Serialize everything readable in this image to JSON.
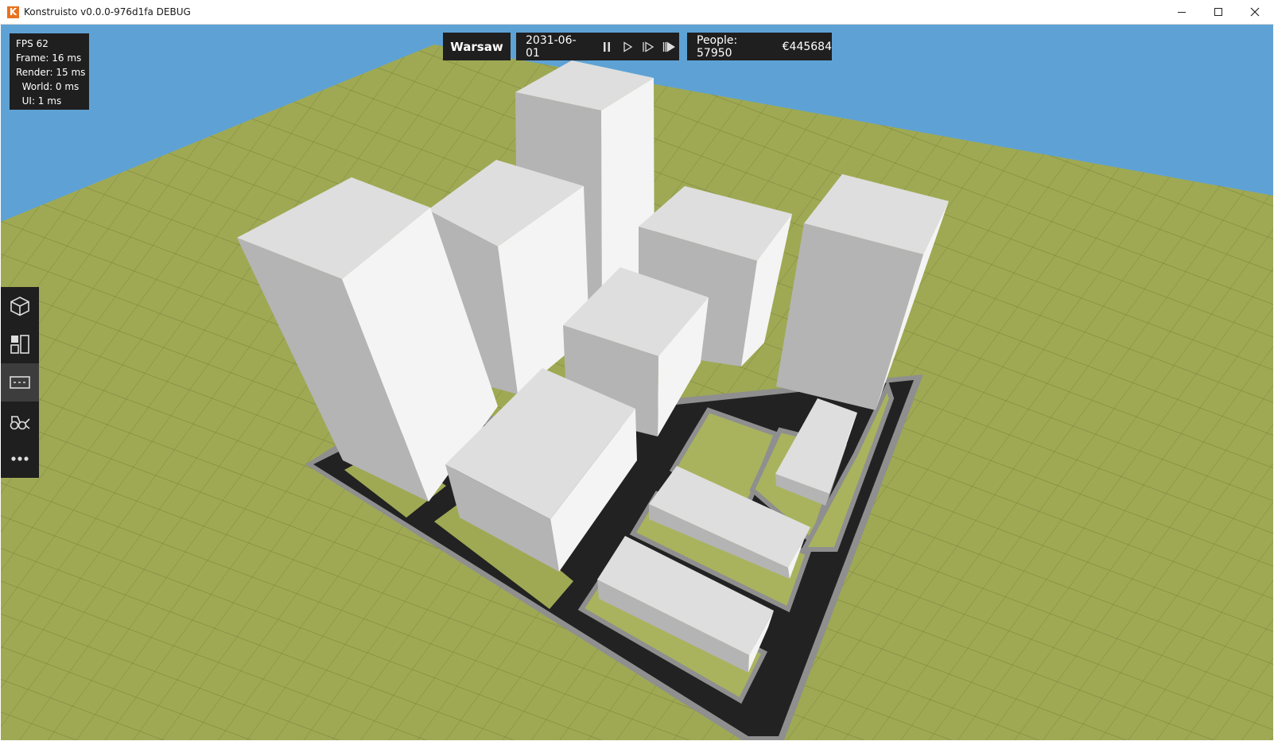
{
  "window": {
    "title": "Konstruisto v0.0.0-976d1fa DEBUG",
    "app_icon_letter": "K",
    "controls": [
      "minimize-icon",
      "maximize-icon",
      "close-icon"
    ]
  },
  "debug": {
    "fps": "FPS 62",
    "frame": "Frame: 16 ms",
    "render": "Render: 15 ms",
    "world": "  World: 0 ms",
    "ui": "  UI: 1 ms"
  },
  "topbar": {
    "city": "Warsaw",
    "date": "2031-06-01",
    "time_controls": [
      "pause-icon",
      "play-icon",
      "fast-forward-icon",
      "fastest-forward-icon"
    ],
    "people": "People: 57950",
    "money": "€445684"
  },
  "sidebar": {
    "items": [
      {
        "icon": "cube-icon",
        "active": false
      },
      {
        "icon": "zones-icon",
        "active": false
      },
      {
        "icon": "road-icon",
        "active": true
      },
      {
        "icon": "bulldozer-icon",
        "active": false
      },
      {
        "icon": "more-icon",
        "active": false
      }
    ]
  },
  "colors": {
    "sky": "#5ea2d5",
    "grass": "#9fa953",
    "road": "#222222",
    "pavement": "#8f8f8f",
    "building_top": "#dedede",
    "building_left": "#b4b4b4",
    "building_right": "#f4f4f4",
    "panel_bg": "#1f1f1f",
    "sidebar_active": "#3d3d3d",
    "app_icon": "#e8711f"
  }
}
